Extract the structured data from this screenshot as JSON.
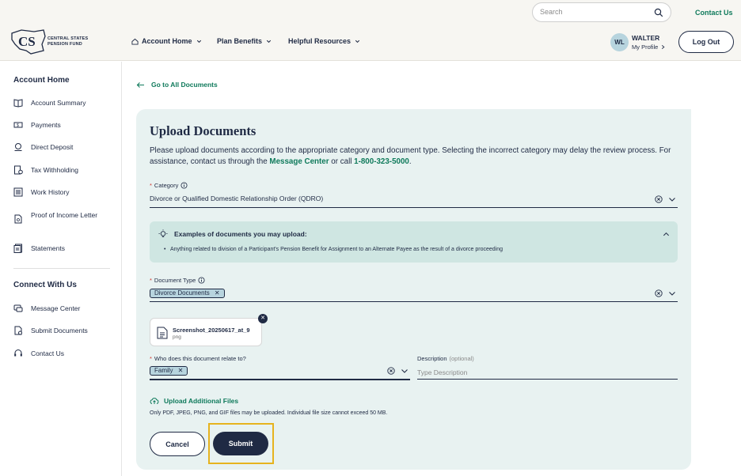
{
  "header": {
    "search_placeholder": "Search",
    "contact_label": "Contact Us",
    "logo_line1": "CENTRAL STATES",
    "logo_line2": "PENSION FUND",
    "nav": [
      {
        "label": "Account Home"
      },
      {
        "label": "Plan Benefits"
      },
      {
        "label": "Helpful Resources"
      }
    ],
    "user": {
      "initials": "WL",
      "name": "WALTER",
      "profile_label": "My Profile"
    },
    "logout_label": "Log Out"
  },
  "sidebar": {
    "heading1": "Account Home",
    "items1": [
      {
        "label": "Account Summary",
        "icon": "book-icon"
      },
      {
        "label": "Payments",
        "icon": "money-icon"
      },
      {
        "label": "Direct Deposit",
        "icon": "bank-icon"
      },
      {
        "label": "Tax Withholding",
        "icon": "tax-icon"
      },
      {
        "label": "Work History",
        "icon": "list-icon"
      },
      {
        "label": "Proof of Income Letter",
        "icon": "document-icon"
      },
      {
        "label": "Statements",
        "icon": "statements-icon"
      }
    ],
    "heading2": "Connect With Us",
    "items2": [
      {
        "label": "Message Center",
        "icon": "message-icon"
      },
      {
        "label": "Submit Documents",
        "icon": "upload-doc-icon"
      },
      {
        "label": "Contact Us",
        "icon": "headset-icon"
      }
    ]
  },
  "main": {
    "back_label": "Go to All Documents",
    "title": "Upload Documents",
    "desc_part1": "Please upload documents according to the appropriate category and document type. Selecting the incorrect category may delay the review process. For assistance, contact us through the ",
    "desc_link": "Message Center",
    "desc_part2": " or call ",
    "desc_phone": "1-800-323-5000",
    "desc_end": ".",
    "category_label": "Category",
    "category_value": "Divorce or Qualified Domestic Relationship Order (QDRO)",
    "examples_title": "Examples of documents you may upload:",
    "examples_item": "Anything related to division of a Participant's Pension Benefit for Assignment to an Alternate Payee as the result of a divorce proceeding",
    "doctype_label": "Document Type",
    "doctype_chip": "Divorce Documents",
    "file_name": "Screenshot_20250617_at_9",
    "file_ext": "png",
    "relate_label": "Who does this document relate to?",
    "relate_chip": "Family",
    "description_label": "Description",
    "description_optional": "(optional)",
    "description_placeholder": "Type Description",
    "upload_more_label": "Upload Additional Files",
    "upload_note": "Only PDF, JPEG, PNG, and GIF files may be uploaded. Individual file size cannot exceed 50 MB.",
    "cancel_label": "Cancel",
    "submit_label": "Submit"
  },
  "colors": {
    "accent": "#0f7a5b",
    "navy": "#1f2a44",
    "card_bg": "#e8f2f1",
    "highlight": "#e6b31e"
  }
}
